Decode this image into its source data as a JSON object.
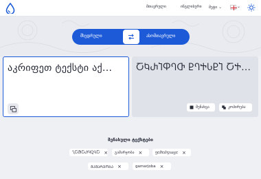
{
  "nav": {
    "item1": "მთავრული",
    "item2": "ინგლისური",
    "item3": "მეტი",
    "item3_chevron": "⌄",
    "flag_chevron": "⌄"
  },
  "translator": {
    "source_language": "მხედრული",
    "target_language": "ასომთავრული",
    "input_text": "აკრიფეთ ტექსტი აქ...",
    "output_text": "ႠႩႰႨႴႤႧ ႲႤႵႱႲႨ ႠႵ...",
    "save_label": "შენახვა",
    "copy_label": "კოპირება"
  },
  "saved": {
    "title": "შენახული ტექსტები",
    "chips": [
      {
        "label": "ႢႠႫႠႰႯႭႡႠ",
        "close": "×"
      },
      {
        "label": "გამარჯობა",
        "close": "×"
      },
      {
        "label": "ⴂⴀⴋⴀⴐⴟⴍⴁⴀ",
        "close": "×"
      },
      {
        "label": "ᲒᲐᲛᲐᲠᲯᲝᲑᲐ",
        "close": "×"
      },
      {
        "label": "gamarjoba",
        "close": "×"
      }
    ]
  },
  "colors": {
    "accent": "#1c5ad8",
    "background": "#eef0f4",
    "panel_output": "#dfe2e8"
  },
  "icons": [
    "drop-logo-icon",
    "swap-arrows-icon",
    "keyboard-icon",
    "save-icon",
    "copy-icon",
    "theme-sun-icon",
    "georgia-flag-icon",
    "close-icon"
  ]
}
